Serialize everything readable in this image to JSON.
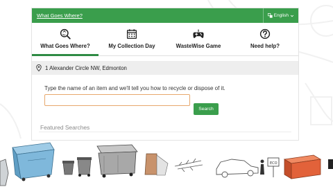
{
  "topbar": {
    "link_label": "What Goes Where?",
    "language_label": "English"
  },
  "tabs": [
    {
      "label": "What Goes Where?",
      "icon": "magnifier-recycle-icon",
      "active": true
    },
    {
      "label": "My Collection Day",
      "icon": "calendar-icon",
      "active": false
    },
    {
      "label": "WasteWise Game",
      "icon": "gamepad-icon",
      "active": false
    },
    {
      "label": "Need help?",
      "icon": "question-icon",
      "active": false
    }
  ],
  "address": {
    "icon": "location-pin-icon",
    "text": "1 Alexander Circle NW, Edmonton"
  },
  "search": {
    "prompt": "Type the name of an item and we'll tell you how to recycle or dispose of it.",
    "value": "",
    "button_label": "Search"
  },
  "featured": {
    "heading": "Featured Searches"
  },
  "illustration": {
    "truck_label": "ECO"
  },
  "colors": {
    "brand_green": "#3a9e4c",
    "input_border": "#e7a76c",
    "orange_container": "#e2623a",
    "blue_bin": "#7fb8db"
  }
}
